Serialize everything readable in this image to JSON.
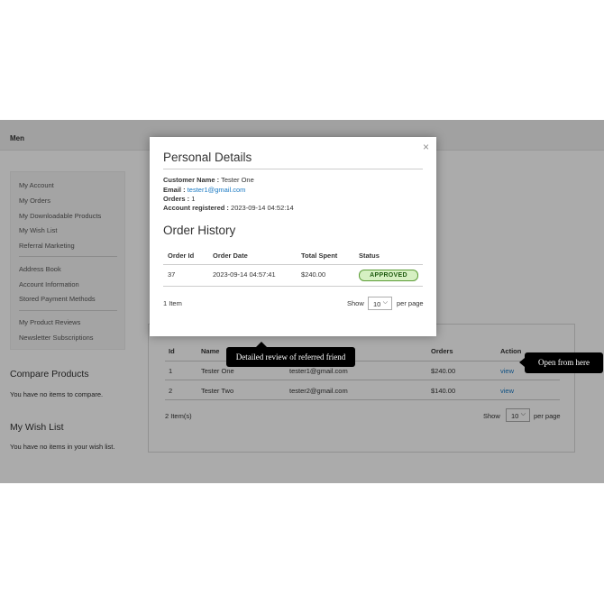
{
  "nav": {
    "item": "Men"
  },
  "sidebar": {
    "items": [
      {
        "label": "My Account"
      },
      {
        "label": "My Orders"
      },
      {
        "label": "My Downloadable Products"
      },
      {
        "label": "My Wish List"
      },
      {
        "label": "Referral Marketing"
      },
      {
        "label": "Address Book"
      },
      {
        "label": "Account Information"
      },
      {
        "label": "Stored Payment Methods"
      },
      {
        "label": "My Product Reviews"
      },
      {
        "label": "Newsletter Subscriptions"
      }
    ]
  },
  "compare": {
    "title": "Compare Products",
    "text": "You have no items to compare."
  },
  "wishlist": {
    "title": "My Wish List",
    "text": "You have no items in your wish list."
  },
  "referrals": {
    "headers": {
      "id": "Id",
      "name": "Name",
      "orders": "Orders",
      "action": "Action"
    },
    "rows": [
      {
        "id": "1",
        "name": "Tester One",
        "email": "tester1@gmail.com",
        "orders": "$240.00",
        "action": "view"
      },
      {
        "id": "2",
        "name": "Tester Two",
        "email": "tester2@gmail.com",
        "orders": "$140.00",
        "action": "view"
      }
    ],
    "count": "2 Item(s)",
    "show_label": "Show",
    "per_page_value": "10",
    "per_page_label": "per page"
  },
  "modal": {
    "close_glyph": "×",
    "personal_title": "Personal Details",
    "customer_name_label": "Customer Name :",
    "customer_name": "Tester One",
    "email_label": "Email :",
    "email": "tester1@gmail.com",
    "orders_label": "Orders :",
    "orders": "1",
    "registered_label": "Account registered :",
    "registered": "2023-09-14 04:52:14",
    "history_title": "Order History",
    "headers": {
      "order_id": "Order Id",
      "order_date": "Order Date",
      "total_spent": "Total Spent",
      "status": "Status"
    },
    "row": {
      "order_id": "37",
      "order_date": "2023-09-14 04:57:41",
      "total_spent": "$240.00",
      "status": "APPROVED"
    },
    "count": "1 Item",
    "show_label": "Show",
    "per_page_value": "10",
    "per_page_label": "per page"
  },
  "tooltips": {
    "review": "Detailed review of referred friend",
    "open": "Open from here"
  },
  "colors": {
    "link": "#1979c3",
    "approved_bg": "#d6f0c2",
    "approved_border": "#5c9d38",
    "tooltip_bg": "#000000"
  },
  "icons": {
    "close": "close-icon",
    "select_chevron": "chevron-down-icon"
  }
}
